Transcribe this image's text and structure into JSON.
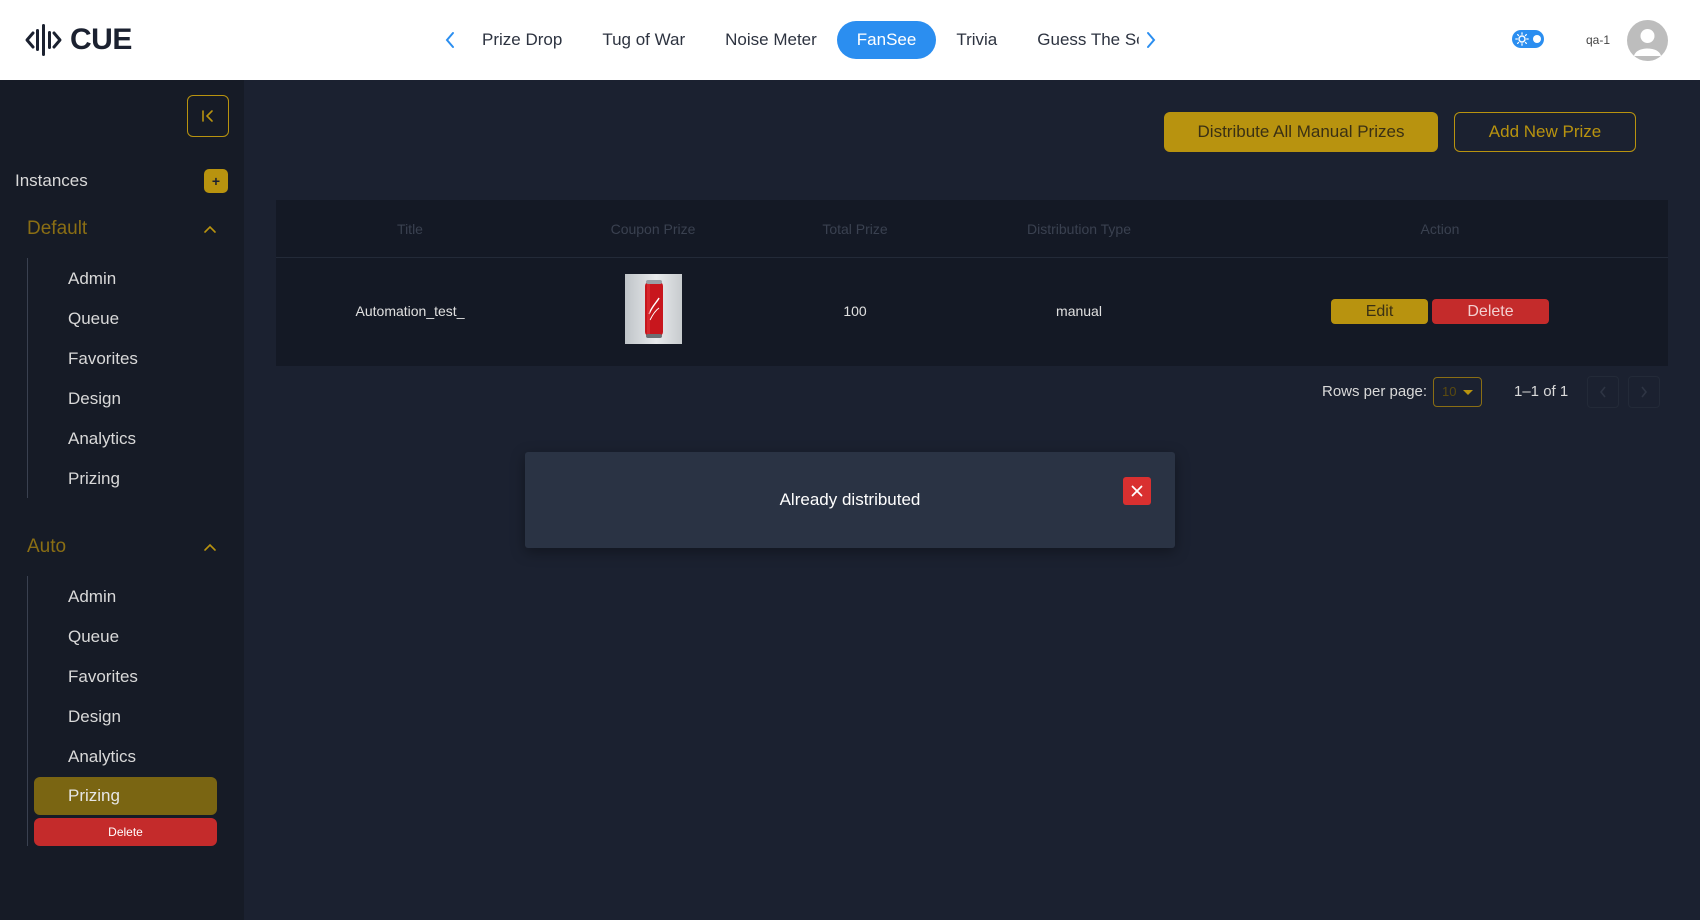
{
  "app": {
    "logo_text": "CUE"
  },
  "header": {
    "tabs": [
      "Prize Drop",
      "Tug of War",
      "Noise Meter",
      "FanSee",
      "Trivia",
      "Guess The Sco"
    ],
    "active_tab": "FanSee",
    "username": "qa-1"
  },
  "sidebar": {
    "instances_label": "Instances",
    "add_label": "+",
    "groups": [
      {
        "title": "Default",
        "items": [
          "Admin",
          "Queue",
          "Favorites",
          "Design",
          "Analytics",
          "Prizing"
        ]
      },
      {
        "title": "Auto",
        "items": [
          "Admin",
          "Queue",
          "Favorites",
          "Design",
          "Analytics",
          "Prizing"
        ]
      }
    ],
    "active_item": "Auto / Prizing",
    "delete_label": "Delete"
  },
  "main": {
    "distribute_label": "Distribute All Manual Prizes",
    "add_label": "Add New Prize",
    "table": {
      "columns": [
        "Title",
        "Coupon Prize",
        "Total Prize",
        "Distribution Type",
        "Action"
      ],
      "rows": [
        {
          "title": "Automation_test_",
          "coupon_prize": "coca-cola-can-image",
          "total_prize": "100",
          "distribution_type": "manual",
          "edit_label": "Edit",
          "delete_label": "Delete"
        }
      ]
    },
    "pagination": {
      "rows_per_page_label": "Rows per page:",
      "rows_per_page_value": "10",
      "range_text": "1–1 of 1"
    }
  },
  "toast": {
    "message": "Already distributed"
  },
  "colors": {
    "accent": "#b8930f",
    "danger": "#c42b2b",
    "primary": "#2b8ef0",
    "background": "#1b2130",
    "sidebar": "#161b26"
  }
}
